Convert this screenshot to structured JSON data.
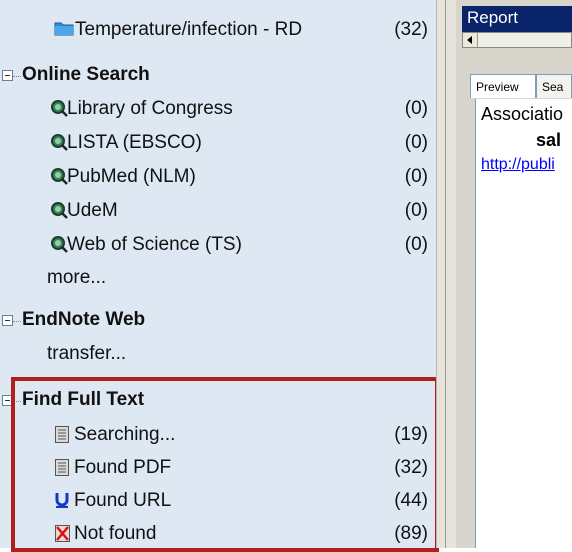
{
  "groups": {
    "top_item": {
      "label": "Temperature/infection - RD",
      "count": "(32)",
      "icon": "folder-icon"
    },
    "online_search": {
      "title": "Online Search",
      "items": [
        {
          "label": "Library of Congress",
          "count": "(0)",
          "icon": "search-globe-icon"
        },
        {
          "label": "LISTA (EBSCO)",
          "count": "(0)",
          "icon": "search-globe-icon"
        },
        {
          "label": "PubMed (NLM)",
          "count": "(0)",
          "icon": "search-globe-icon"
        },
        {
          "label": "UdeM",
          "count": "(0)",
          "icon": "search-globe-icon"
        },
        {
          "label": "Web of Science (TS)",
          "count": "(0)",
          "icon": "search-globe-icon"
        }
      ],
      "more": "more..."
    },
    "endnote_web": {
      "title": "EndNote Web",
      "transfer": "transfer..."
    },
    "find_full_text": {
      "title": "Find Full Text",
      "items": [
        {
          "label": "Searching...",
          "count": "(19)",
          "icon": "document-icon"
        },
        {
          "label": "Found PDF",
          "count": "(32)",
          "icon": "document-icon"
        },
        {
          "label": "Found URL",
          "count": "(44)",
          "icon": "url-icon"
        },
        {
          "label": "Not found",
          "count": "(89)",
          "icon": "not-found-icon"
        }
      ]
    }
  },
  "right": {
    "report_label": "Report",
    "tabs": [
      "Preview",
      "Sea"
    ],
    "preview_lines": [
      "Associatio",
      "sal",
      "http://publi"
    ]
  },
  "colors": {
    "highlight": "#b01e1e",
    "pane_bg": "#dde8f3",
    "report_bg": "#0a246a",
    "link": "#0000ff"
  }
}
